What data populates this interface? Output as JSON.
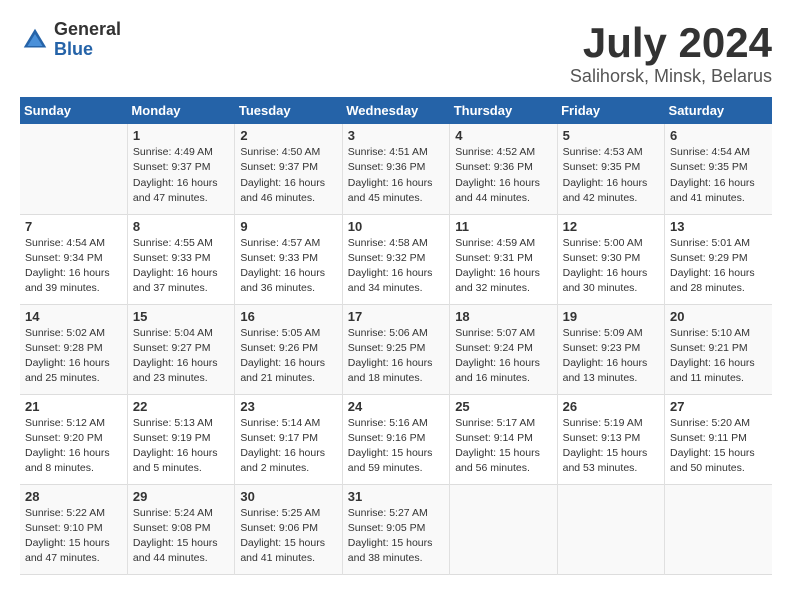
{
  "header": {
    "logo_general": "General",
    "logo_blue": "Blue",
    "title": "July 2024",
    "location": "Salihorsk, Minsk, Belarus"
  },
  "weekdays": [
    "Sunday",
    "Monday",
    "Tuesday",
    "Wednesday",
    "Thursday",
    "Friday",
    "Saturday"
  ],
  "weeks": [
    [
      {
        "day": "",
        "info": ""
      },
      {
        "day": "1",
        "info": "Sunrise: 4:49 AM\nSunset: 9:37 PM\nDaylight: 16 hours\nand 47 minutes."
      },
      {
        "day": "2",
        "info": "Sunrise: 4:50 AM\nSunset: 9:37 PM\nDaylight: 16 hours\nand 46 minutes."
      },
      {
        "day": "3",
        "info": "Sunrise: 4:51 AM\nSunset: 9:36 PM\nDaylight: 16 hours\nand 45 minutes."
      },
      {
        "day": "4",
        "info": "Sunrise: 4:52 AM\nSunset: 9:36 PM\nDaylight: 16 hours\nand 44 minutes."
      },
      {
        "day": "5",
        "info": "Sunrise: 4:53 AM\nSunset: 9:35 PM\nDaylight: 16 hours\nand 42 minutes."
      },
      {
        "day": "6",
        "info": "Sunrise: 4:54 AM\nSunset: 9:35 PM\nDaylight: 16 hours\nand 41 minutes."
      }
    ],
    [
      {
        "day": "7",
        "info": "Sunrise: 4:54 AM\nSunset: 9:34 PM\nDaylight: 16 hours\nand 39 minutes."
      },
      {
        "day": "8",
        "info": "Sunrise: 4:55 AM\nSunset: 9:33 PM\nDaylight: 16 hours\nand 37 minutes."
      },
      {
        "day": "9",
        "info": "Sunrise: 4:57 AM\nSunset: 9:33 PM\nDaylight: 16 hours\nand 36 minutes."
      },
      {
        "day": "10",
        "info": "Sunrise: 4:58 AM\nSunset: 9:32 PM\nDaylight: 16 hours\nand 34 minutes."
      },
      {
        "day": "11",
        "info": "Sunrise: 4:59 AM\nSunset: 9:31 PM\nDaylight: 16 hours\nand 32 minutes."
      },
      {
        "day": "12",
        "info": "Sunrise: 5:00 AM\nSunset: 9:30 PM\nDaylight: 16 hours\nand 30 minutes."
      },
      {
        "day": "13",
        "info": "Sunrise: 5:01 AM\nSunset: 9:29 PM\nDaylight: 16 hours\nand 28 minutes."
      }
    ],
    [
      {
        "day": "14",
        "info": "Sunrise: 5:02 AM\nSunset: 9:28 PM\nDaylight: 16 hours\nand 25 minutes."
      },
      {
        "day": "15",
        "info": "Sunrise: 5:04 AM\nSunset: 9:27 PM\nDaylight: 16 hours\nand 23 minutes."
      },
      {
        "day": "16",
        "info": "Sunrise: 5:05 AM\nSunset: 9:26 PM\nDaylight: 16 hours\nand 21 minutes."
      },
      {
        "day": "17",
        "info": "Sunrise: 5:06 AM\nSunset: 9:25 PM\nDaylight: 16 hours\nand 18 minutes."
      },
      {
        "day": "18",
        "info": "Sunrise: 5:07 AM\nSunset: 9:24 PM\nDaylight: 16 hours\nand 16 minutes."
      },
      {
        "day": "19",
        "info": "Sunrise: 5:09 AM\nSunset: 9:23 PM\nDaylight: 16 hours\nand 13 minutes."
      },
      {
        "day": "20",
        "info": "Sunrise: 5:10 AM\nSunset: 9:21 PM\nDaylight: 16 hours\nand 11 minutes."
      }
    ],
    [
      {
        "day": "21",
        "info": "Sunrise: 5:12 AM\nSunset: 9:20 PM\nDaylight: 16 hours\nand 8 minutes."
      },
      {
        "day": "22",
        "info": "Sunrise: 5:13 AM\nSunset: 9:19 PM\nDaylight: 16 hours\nand 5 minutes."
      },
      {
        "day": "23",
        "info": "Sunrise: 5:14 AM\nSunset: 9:17 PM\nDaylight: 16 hours\nand 2 minutes."
      },
      {
        "day": "24",
        "info": "Sunrise: 5:16 AM\nSunset: 9:16 PM\nDaylight: 15 hours\nand 59 minutes."
      },
      {
        "day": "25",
        "info": "Sunrise: 5:17 AM\nSunset: 9:14 PM\nDaylight: 15 hours\nand 56 minutes."
      },
      {
        "day": "26",
        "info": "Sunrise: 5:19 AM\nSunset: 9:13 PM\nDaylight: 15 hours\nand 53 minutes."
      },
      {
        "day": "27",
        "info": "Sunrise: 5:20 AM\nSunset: 9:11 PM\nDaylight: 15 hours\nand 50 minutes."
      }
    ],
    [
      {
        "day": "28",
        "info": "Sunrise: 5:22 AM\nSunset: 9:10 PM\nDaylight: 15 hours\nand 47 minutes."
      },
      {
        "day": "29",
        "info": "Sunrise: 5:24 AM\nSunset: 9:08 PM\nDaylight: 15 hours\nand 44 minutes."
      },
      {
        "day": "30",
        "info": "Sunrise: 5:25 AM\nSunset: 9:06 PM\nDaylight: 15 hours\nand 41 minutes."
      },
      {
        "day": "31",
        "info": "Sunrise: 5:27 AM\nSunset: 9:05 PM\nDaylight: 15 hours\nand 38 minutes."
      },
      {
        "day": "",
        "info": ""
      },
      {
        "day": "",
        "info": ""
      },
      {
        "day": "",
        "info": ""
      }
    ]
  ]
}
